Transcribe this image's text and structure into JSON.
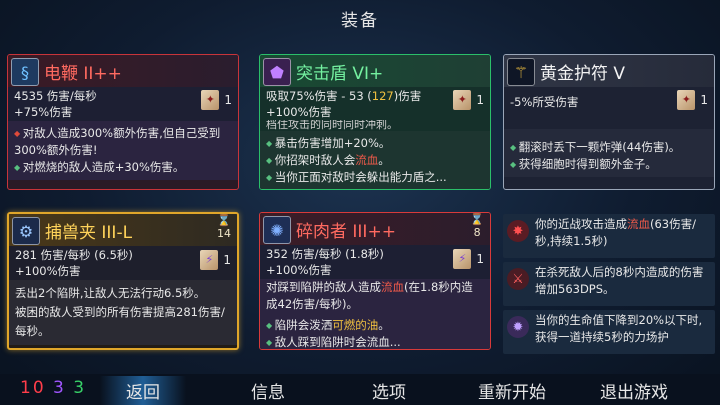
{
  "title": "装备",
  "cards": [
    {
      "name": "电鞭 II++",
      "stats": [
        "4535 伤害/每秒",
        "+75%伤害"
      ],
      "scroll_count": "1",
      "body": [
        {
          "text": "对敌人造成300%额外伤害,但自己受到300%额外伤害!",
          "style": "red"
        },
        {
          "text": "对燃烧的敌人造成+30%伤害。",
          "style": "green"
        }
      ]
    },
    {
      "name": "突击盾 VI+",
      "stats_prefix": "吸取75%伤害 - 53 (",
      "stats_hl": "127",
      "stats_suffix": ")伤害",
      "stats2": "+100%伤害",
      "cut_text": "档住攻击的同时同时冲刺。",
      "scroll_count": "1",
      "body": [
        {
          "text": "暴击伤害增加+20%。"
        },
        {
          "text_a": "你招架时敌人会",
          "text_hl": "流血",
          "text_b": "。"
        },
        {
          "text": "当你正面对敌时会躲出能力盾之..."
        }
      ]
    },
    {
      "name": "黄金护符 V",
      "stats": [
        "-5%所受伤害"
      ],
      "scroll_count": "1",
      "body": [
        {
          "text": "翻滚时丢下一颗炸弹(44伤害)。"
        },
        {
          "text": "获得细胞时得到额外金子。"
        }
      ]
    },
    {
      "name": "捕兽夹 III-L",
      "stats": [
        "281 伤害/每秒 (6.5秒)",
        "+100%伤害"
      ],
      "cooldown": "14",
      "scroll_count": "1",
      "body": [
        {
          "text": "丢出2个陷阱,让敌人无法行动6.5秒。"
        },
        {
          "text": "被困的敌人受到的所有伤害提高281伤害/每秒。"
        }
      ]
    },
    {
      "name": "碎肉者 III++",
      "stats": [
        "352 伤害/每秒 (1.8秒)",
        "+100%伤害"
      ],
      "cooldown": "8",
      "scroll_count": "1",
      "body_top_a": "对踩到陷阱的敌人造成",
      "body_top_hl": "流血",
      "body_top_b": "(在1.8秒内造成42伤害/每秒)。",
      "body": [
        {
          "text_a": "陷阱会泼洒",
          "text_hl": "可燃的油",
          "text_b": "。"
        },
        {
          "text": "敌人踩到陷阱时会流血..."
        }
      ]
    }
  ],
  "passives": [
    {
      "text_a": "你的近战攻击造成",
      "text_hl": "流血",
      "text_b": "(63伤害/秒,持续1.5秒)"
    },
    {
      "text": "在杀死敌人后的8秒内造成的伤害增加563DPS。"
    },
    {
      "text": "当你的生命值下降到20%以下时,获得一道持续5秒的力场护"
    }
  ],
  "scrolls": {
    "brutality": "10",
    "tactics": "3",
    "survival": "3"
  },
  "menu": [
    "返回",
    "信息",
    "选项",
    "重新开始",
    "退出游戏"
  ],
  "icons": {
    "electric_whip": "whip-icon",
    "assault_shield": "shield-icon",
    "gold_amulet": "amulet-icon",
    "wolf_trap": "trap-icon",
    "meat_grinder": "grinder-icon",
    "cooldown": "hourglass-icon",
    "scroll": "scroll-icon"
  }
}
